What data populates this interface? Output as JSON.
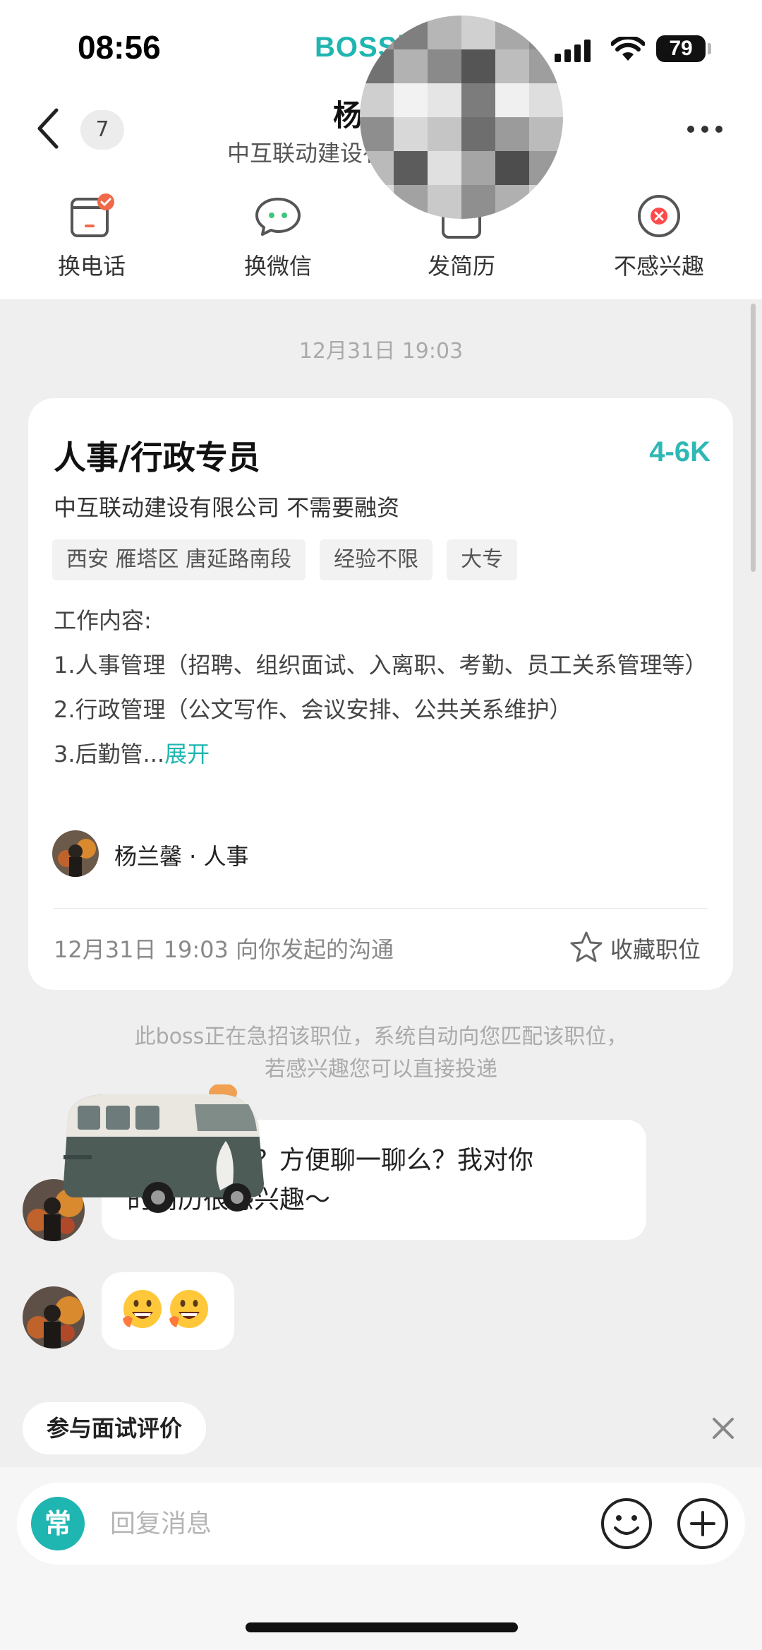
{
  "status_bar": {
    "time": "08:56",
    "app_label": "BOSS直",
    "battery": "79"
  },
  "header": {
    "back_count": "7",
    "name": "杨兰馨",
    "company": "中互联动建设有限公司"
  },
  "actions": [
    {
      "label": "换电话",
      "icon": "phone-swap-icon"
    },
    {
      "label": "换微信",
      "icon": "wechat-swap-icon"
    },
    {
      "label": "发简历",
      "icon": "resume-send-icon"
    },
    {
      "label": "不感兴趣",
      "icon": "not-interested-icon"
    }
  ],
  "chat": {
    "timestamp": "12月31日 19:03",
    "job_card": {
      "title": "人事/行政专员",
      "salary": "4-6K",
      "company_info": "中互联动建设有限公司 不需要融资",
      "tags": [
        "西安 雁塔区 唐延路南段",
        "经验不限",
        "大专"
      ],
      "desc_heading": "工作内容:",
      "desc_line1": "1.人事管理（招聘、组织面试、入离职、考勤、员工关系管理等）",
      "desc_line2": "2.行政管理（公文写作、会议安排、公共关系维护）",
      "desc_line3": "3.后勤管...",
      "expand_label": "展开",
      "recruiter": "杨兰馨 · 人事",
      "footer": "12月31日 19:03 向你发起的沟通",
      "favorite_label": "收藏职位"
    },
    "system_note_line1": "此boss正在急招该职位，系统自动向您匹配该职位，",
    "system_note_line2": "若感兴趣您可以直接投递",
    "messages": [
      {
        "text_line1": "您好，在么？方便聊一聊么？我对你",
        "text_line2": "的简历很感兴趣～"
      },
      {
        "emoji": "😃😃"
      }
    ]
  },
  "eval_chip": "参与面试评价",
  "input": {
    "badge": "常",
    "placeholder": "回复消息"
  },
  "colors": {
    "accent": "#1fb5b0",
    "background": "#efefef"
  }
}
